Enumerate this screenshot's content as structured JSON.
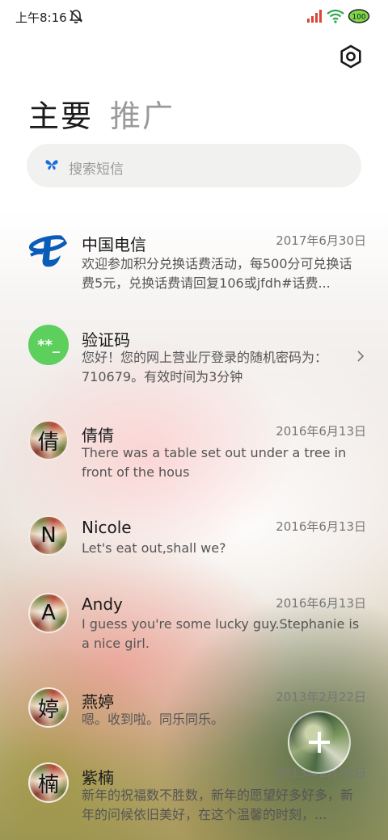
{
  "status": {
    "time": "上午8:16",
    "battery": "100"
  },
  "tabs": {
    "main": "主要",
    "promo": "推广"
  },
  "search": {
    "placeholder": "搜索短信"
  },
  "conversations": [
    {
      "name": "中国电信",
      "date": "2017年6月30日",
      "preview": "欢迎参加积分兑换话费活动，每500分可兑换话费5元，兑换话费请回复106或jfdh#话费...",
      "avatar": "telecom-logo"
    },
    {
      "name": "验证码",
      "date": "",
      "preview": "您好！您的网上营业厅登录的随机密码为：710679。有效时间为3分钟",
      "avatar_text": "**_"
    },
    {
      "name": "倩倩",
      "date": "2016年6月13日",
      "preview": "There was a table set out under a tree in front of the hous",
      "avatar_text": "倩"
    },
    {
      "name": "Nicole",
      "date": "2016年6月13日",
      "preview": "Let's eat out,shall we?",
      "avatar_text": "N"
    },
    {
      "name": "Andy",
      "date": "2016年6月13日",
      "preview": "I guess you're some lucky guy.Stephanie is a nice girl.",
      "avatar_text": "A"
    },
    {
      "name": "燕婷",
      "date": "2013年2月22日",
      "preview": "嗯。收到啦。同乐同乐。",
      "avatar_text": "婷"
    },
    {
      "name": "紫楠",
      "date": "2013年2月22日",
      "preview": "新年的祝福数不胜数，新年的愿望好多好多，新年的问候依旧美好，在这个温馨的时刻，...",
      "avatar_text": "楠"
    }
  ],
  "colors": {
    "telecom_blue": "#0a5cb8",
    "code_green": "#5ccf5c",
    "accent": "#1a1a1a"
  }
}
